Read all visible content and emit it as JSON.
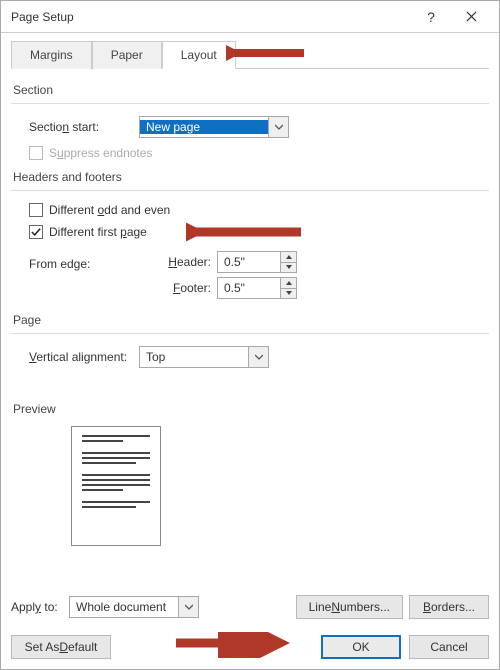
{
  "title": "Page Setup",
  "tabs": {
    "margins": "Margins",
    "paper": "Paper",
    "layout": "Layout"
  },
  "section": {
    "label": "Section",
    "start_label": "Section start:",
    "start_value": "New page",
    "suppress_label": "Suppress endnotes"
  },
  "hf": {
    "label": "Headers and footers",
    "diff_odd_even": "Different odd and even",
    "diff_first": "Different first page",
    "from_edge": "From edge:",
    "header_label": "Header:",
    "footer_label": "Footer:",
    "header_val": "0.5\"",
    "footer_val": "0.5\""
  },
  "page": {
    "label": "Page",
    "valign_label": "Vertical alignment:",
    "valign_val": "Top"
  },
  "preview": {
    "label": "Preview"
  },
  "apply": {
    "label": "Apply to:",
    "value": "Whole document",
    "line_numbers": "Line Numbers...",
    "borders": "Borders..."
  },
  "footer": {
    "default": "Set As Default",
    "ok": "OK",
    "cancel": "Cancel"
  }
}
